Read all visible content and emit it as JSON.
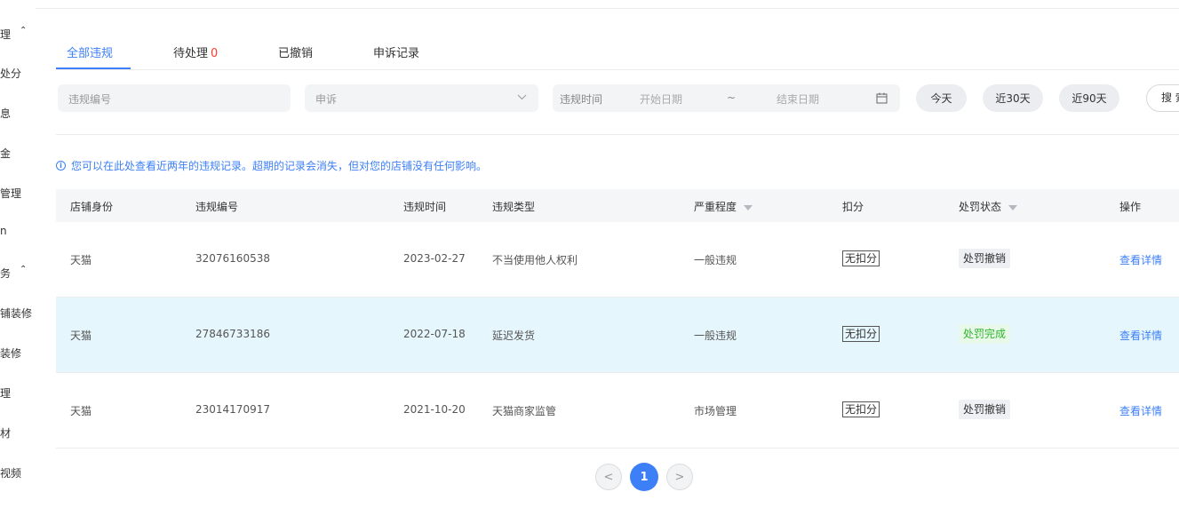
{
  "sidebar": {
    "items": [
      {
        "label": "理",
        "caret": "⌃"
      },
      {
        "label": "处分"
      },
      {
        "label": "息"
      },
      {
        "label": "金"
      },
      {
        "label": "管理"
      },
      {
        "label": "n"
      },
      {
        "label": "务",
        "caret": "⌃"
      },
      {
        "label": "铺装修"
      },
      {
        "label": "装修"
      },
      {
        "label": "理"
      },
      {
        "label": "材"
      },
      {
        "label": "视频"
      }
    ]
  },
  "tabs": [
    {
      "label": "全部违规",
      "active": true
    },
    {
      "label": "待处理",
      "count": "0"
    },
    {
      "label": "已撤销"
    },
    {
      "label": "申诉记录"
    }
  ],
  "filters": {
    "violation_no_placeholder": "违规编号",
    "appeal_select": "申诉",
    "time_label": "违规时间",
    "start_placeholder": "开始日期",
    "range_sep": "~",
    "end_placeholder": "结束日期",
    "chips": [
      "今天",
      "近30天",
      "近90天"
    ],
    "search_label": "搜 索"
  },
  "notice": "您可以在此处查看近两年的违规记录。超期的记录会消失，但对您的店铺没有任何影响。",
  "table": {
    "headers": [
      "店铺身份",
      "违规编号",
      "违规时间",
      "违规类型",
      "严重程度",
      "扣分",
      "处罚状态",
      "操作"
    ],
    "rows": [
      {
        "identity": "天猫",
        "no": "32076160538",
        "time": "2023-02-27",
        "type": "不当使用他人权利",
        "severity": "一般违规",
        "deduct": "无扣分",
        "status": "处罚撤销",
        "status_kind": "gray",
        "action": "查看详情"
      },
      {
        "identity": "天猫",
        "no": "27846733186",
        "time": "2022-07-18",
        "type": "延迟发货",
        "severity": "一般违规",
        "deduct": "无扣分",
        "status": "处罚完成",
        "status_kind": "green",
        "action": "查看详情"
      },
      {
        "identity": "天猫",
        "no": "23014170917",
        "time": "2021-10-20",
        "type": "天猫商家监管",
        "severity": "市场管理",
        "deduct": "无扣分",
        "status": "处罚撤销",
        "status_kind": "gray",
        "action": "查看详情"
      }
    ]
  },
  "pagination": {
    "prev": "<",
    "current": "1",
    "next": ">"
  },
  "colors": {
    "accent": "#3d7ff7",
    "danger": "#ff3b30",
    "success": "#2fb52f",
    "highlight_row": "#e6f6fd"
  }
}
